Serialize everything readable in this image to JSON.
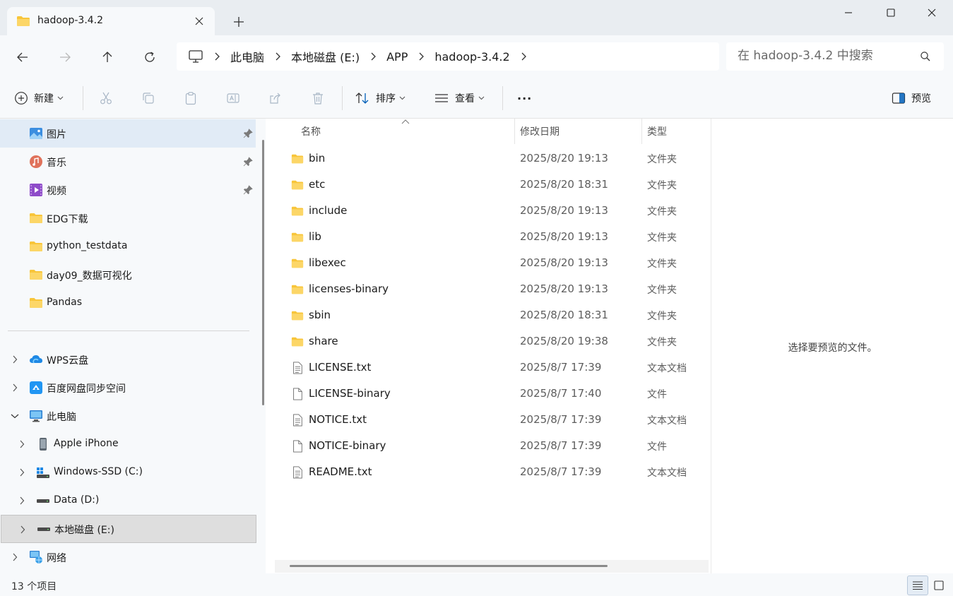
{
  "window": {
    "tab_title": "hadoop-3.4.2"
  },
  "breadcrumb": [
    "此电脑",
    "本地磁盘 (E:)",
    "APP",
    "hadoop-3.4.2"
  ],
  "search": {
    "placeholder": "在 hadoop-3.4.2 中搜索"
  },
  "toolbar": {
    "new_label": "新建",
    "sort_label": "排序",
    "view_label": "查看",
    "more_label": "···",
    "preview_label": "预览"
  },
  "sidebar": {
    "quick_access": [
      {
        "label": "图片",
        "icon": "pictures-icon",
        "pinned": true,
        "selected": true
      },
      {
        "label": "音乐",
        "icon": "music-icon",
        "pinned": true
      },
      {
        "label": "视频",
        "icon": "video-icon",
        "pinned": true
      },
      {
        "label": "EDG下载",
        "icon": "folder-icon"
      },
      {
        "label": "python_testdata",
        "icon": "folder-icon"
      },
      {
        "label": "day09_数据可视化",
        "icon": "folder-icon"
      },
      {
        "label": "Pandas",
        "icon": "folder-icon"
      }
    ],
    "locations": [
      {
        "label": "WPS云盘",
        "icon": "cloud-icon"
      },
      {
        "label": "百度网盘同步空间",
        "icon": "baidu-netdisk-icon"
      },
      {
        "label": "此电脑",
        "icon": "computer-icon",
        "expanded": true
      },
      {
        "label": "Apple iPhone",
        "icon": "phone-icon"
      },
      {
        "label": "Windows-SSD (C:)",
        "icon": "system-drive-icon"
      },
      {
        "label": "Data (D:)",
        "icon": "drive-icon"
      },
      {
        "label": "本地磁盘 (E:)",
        "icon": "drive-icon",
        "highlighted": true
      },
      {
        "label": "网络",
        "icon": "network-icon"
      }
    ]
  },
  "filelist": {
    "columns": {
      "name": "名称",
      "date": "修改日期",
      "type": "类型"
    },
    "rows": [
      {
        "name": "bin",
        "date": "2025/8/20 19:13",
        "type": "文件夹",
        "kind": "folder"
      },
      {
        "name": "etc",
        "date": "2025/8/20 18:31",
        "type": "文件夹",
        "kind": "folder"
      },
      {
        "name": "include",
        "date": "2025/8/20 19:13",
        "type": "文件夹",
        "kind": "folder"
      },
      {
        "name": "lib",
        "date": "2025/8/20 19:13",
        "type": "文件夹",
        "kind": "folder"
      },
      {
        "name": "libexec",
        "date": "2025/8/20 19:13",
        "type": "文件夹",
        "kind": "folder"
      },
      {
        "name": "licenses-binary",
        "date": "2025/8/20 19:13",
        "type": "文件夹",
        "kind": "folder"
      },
      {
        "name": "sbin",
        "date": "2025/8/20 18:31",
        "type": "文件夹",
        "kind": "folder"
      },
      {
        "name": "share",
        "date": "2025/8/20 19:38",
        "type": "文件夹",
        "kind": "folder"
      },
      {
        "name": "LICENSE.txt",
        "date": "2025/8/7 17:39",
        "type": "文本文档",
        "kind": "text"
      },
      {
        "name": "LICENSE-binary",
        "date": "2025/8/7 17:40",
        "type": "文件",
        "kind": "file"
      },
      {
        "name": "NOTICE.txt",
        "date": "2025/8/7 17:39",
        "type": "文本文档",
        "kind": "text"
      },
      {
        "name": "NOTICE-binary",
        "date": "2025/8/7 17:39",
        "type": "文件",
        "kind": "file"
      },
      {
        "name": "README.txt",
        "date": "2025/8/7 17:39",
        "type": "文本文档",
        "kind": "text"
      }
    ]
  },
  "preview": {
    "empty_text": "选择要预览的文件。"
  },
  "status": {
    "item_count": "13 个项目"
  },
  "colors": {
    "folder": "#f8c53a",
    "accent": "#005fb8",
    "selected_bg": "#e1ebf6",
    "highlight_bg": "#dedede"
  }
}
